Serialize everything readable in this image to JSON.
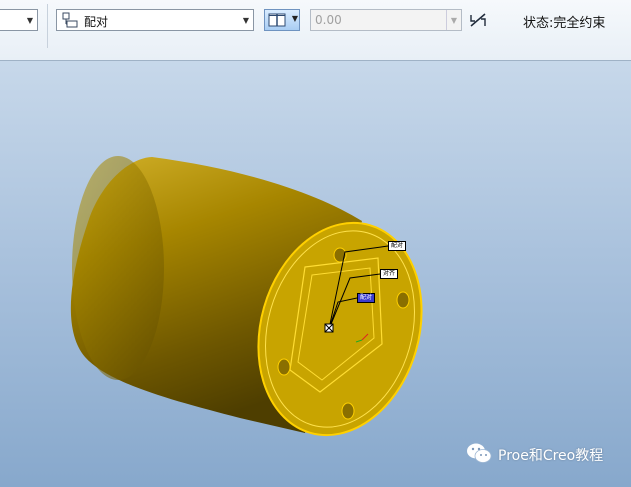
{
  "toolbar": {
    "constraint_type": {
      "value": "配对",
      "icon": "mate-constraint-icon"
    },
    "offset_input": {
      "value": "0.00"
    },
    "flip_icon": "flip-constraint-icon",
    "orientation_icon": "coincident-orientation-icon",
    "status": "状态:完全约束"
  },
  "viewport": {
    "labels": [
      "配对",
      "对齐",
      "配对"
    ],
    "background_top": "#c7d8ea",
    "background_bottom": "#87a8cc",
    "part_color": "#c8a400",
    "highlight_color": "#ffd000"
  },
  "watermark": {
    "text": "Proe和Creo教程",
    "icon": "wechat-icon"
  }
}
